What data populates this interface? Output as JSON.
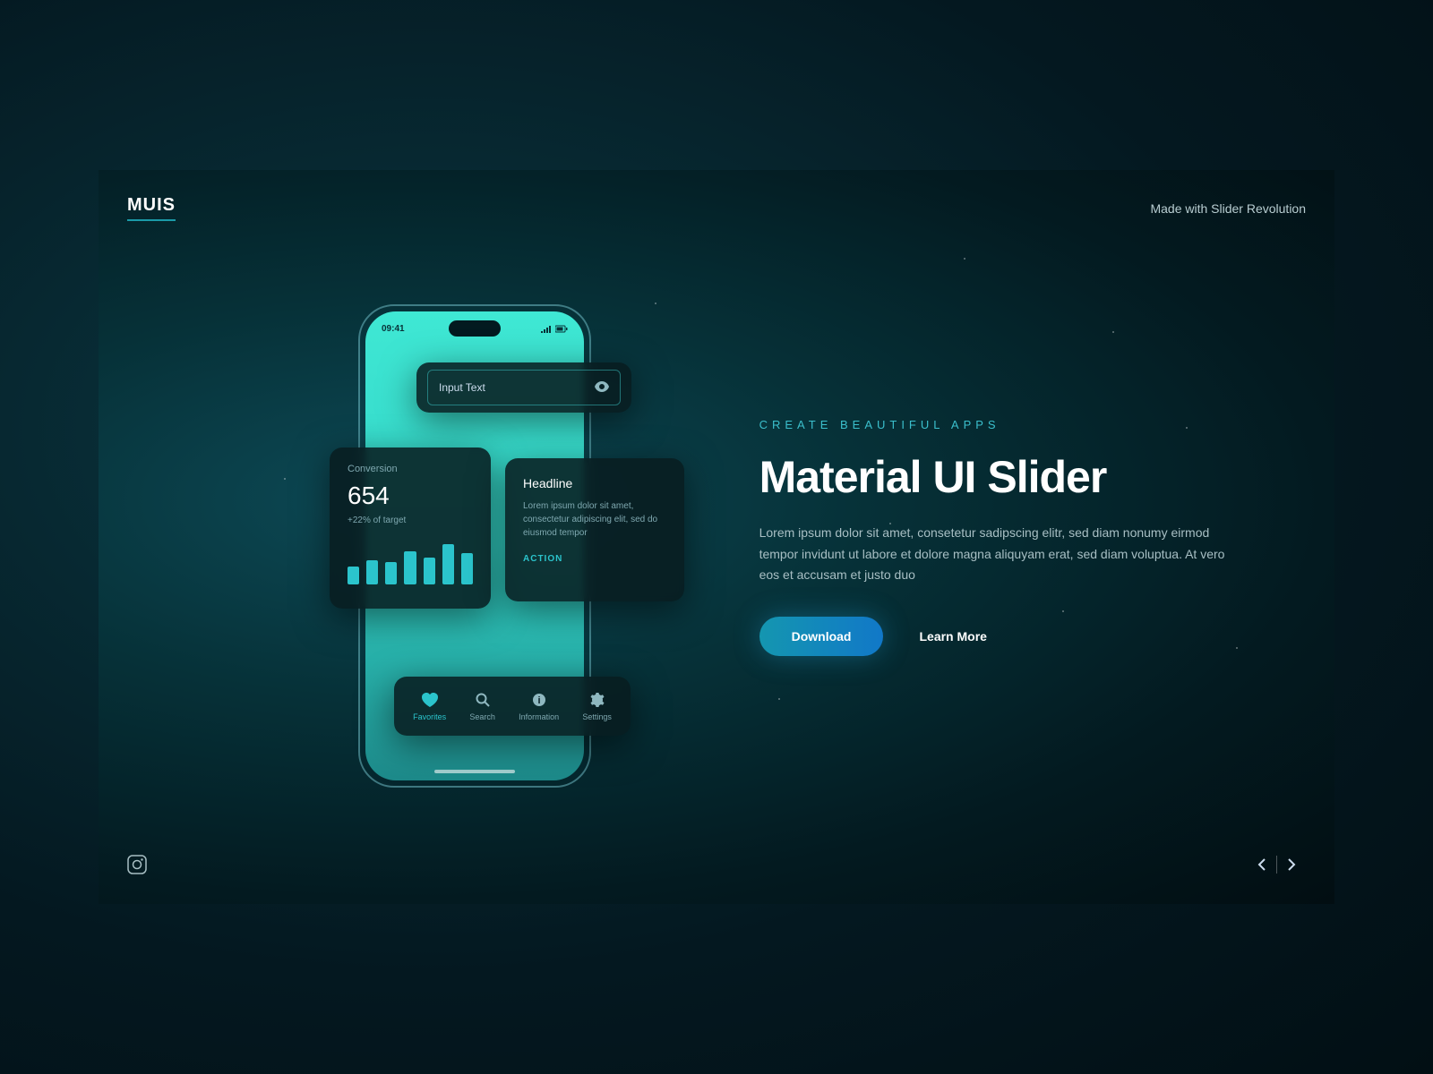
{
  "header": {
    "logo": "MUIS",
    "tagline": "Made with Slider Revolution"
  },
  "phone": {
    "time": "09:41",
    "inputPlaceholder": "Input Text",
    "stat": {
      "label": "Conversion",
      "value": "654",
      "sub": "+22% of target",
      "bars": [
        40,
        55,
        50,
        75,
        60,
        90,
        70
      ]
    },
    "headlineCard": {
      "title": "Headline",
      "body": "Lorem ipsum dolor sit amet, consectetur adipiscing elit, sed do eiusmod tempor",
      "action": "ACTION"
    },
    "nav": [
      {
        "label": "Favorites",
        "icon": "heart-icon",
        "active": true
      },
      {
        "label": "Search",
        "icon": "search-icon",
        "active": false
      },
      {
        "label": "Information",
        "icon": "info-icon",
        "active": false
      },
      {
        "label": "Settings",
        "icon": "gear-icon",
        "active": false
      }
    ]
  },
  "hero": {
    "eyebrow": "CREATE BEAUTIFUL APPS",
    "headline": "Material UI Slider",
    "body": "Lorem ipsum dolor sit amet, consetetur sadipscing elitr, sed diam nonumy eirmod tempor invidunt ut labore et dolore magna aliquyam erat, sed diam voluptua. At vero eos et accusam et justo duo",
    "primaryCta": "Download",
    "secondaryCta": "Learn More"
  }
}
